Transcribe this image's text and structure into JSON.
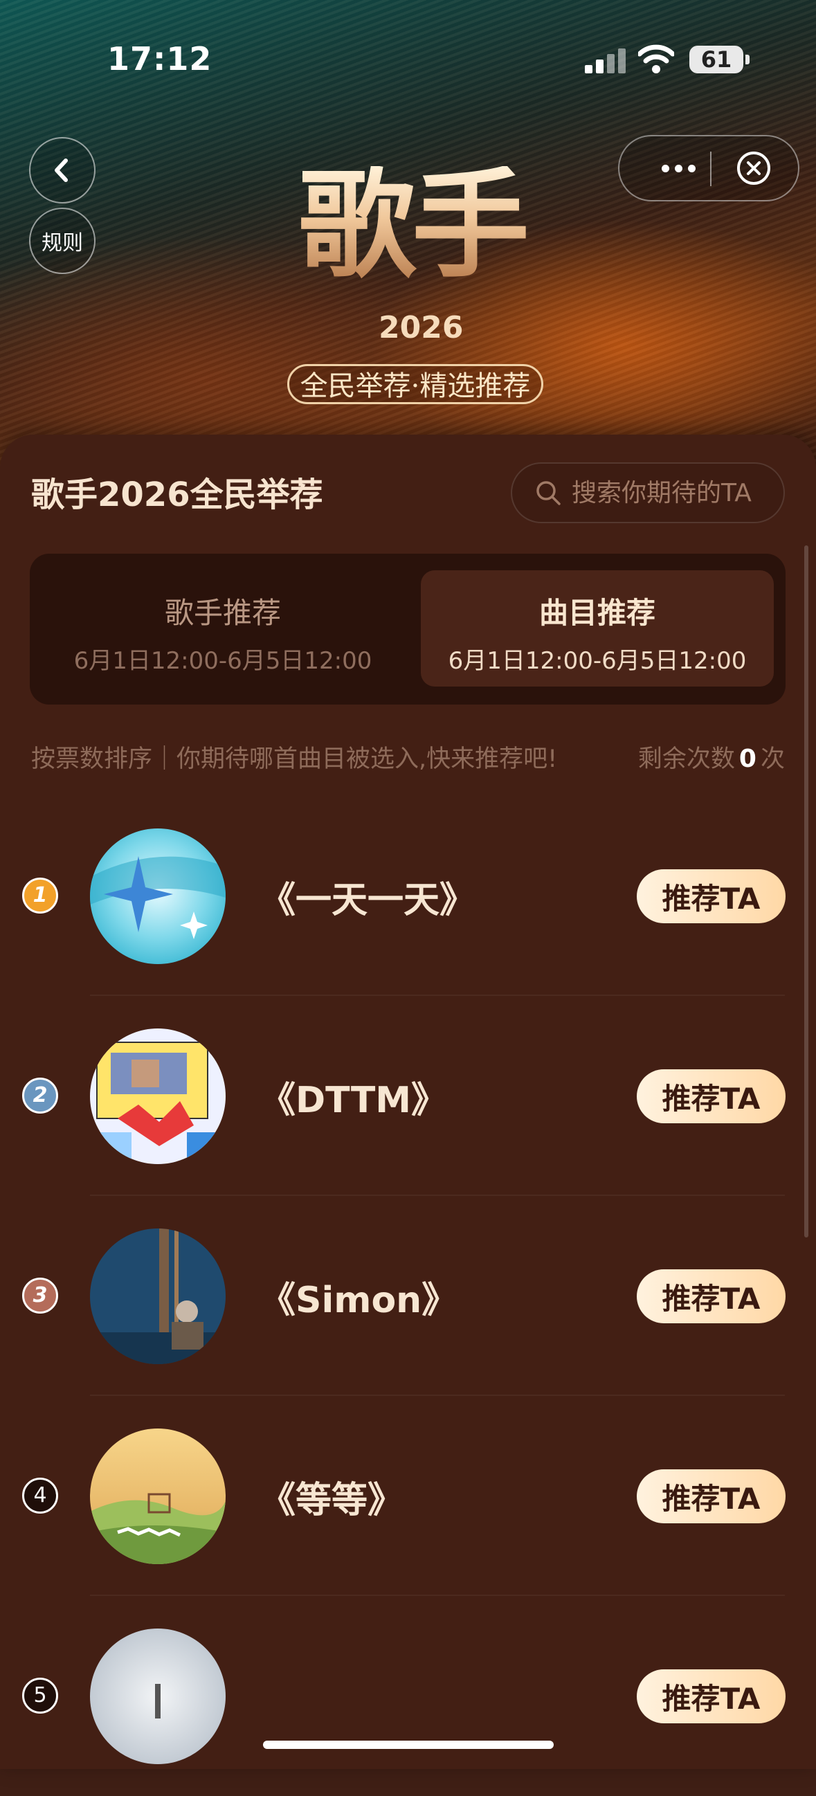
{
  "status_bar": {
    "time": "17:12",
    "battery": "61"
  },
  "nav": {
    "rules_label": "规则"
  },
  "banner": {
    "title": "歌手",
    "year": "2026",
    "subtitle": "全民举荐·精选推荐"
  },
  "panel": {
    "title": "歌手2026全民举荐",
    "search_placeholder": "搜索你期待的TA"
  },
  "tabs": [
    {
      "label": "歌手推荐",
      "time": "6月1日12:00-6月5日12:00",
      "active": false
    },
    {
      "label": "曲目推荐",
      "time": "6月1日12:00-6月5日12:00",
      "active": true
    }
  ],
  "hint": "按票数排序｜你期待哪首曲目被选入,快来推荐吧!",
  "remaining": {
    "prefix": "剩余次数",
    "count": "0",
    "suffix": "次"
  },
  "songs": [
    {
      "rank": "1",
      "title": "《一天一天》",
      "button": "推荐TA"
    },
    {
      "rank": "2",
      "title": "《DTTM》",
      "button": "推荐TA"
    },
    {
      "rank": "3",
      "title": "《Simon》",
      "button": "推荐TA"
    },
    {
      "rank": "4",
      "title": "《等等》",
      "button": "推荐TA"
    },
    {
      "rank": "5",
      "title": "",
      "button": "推荐TA"
    }
  ]
}
